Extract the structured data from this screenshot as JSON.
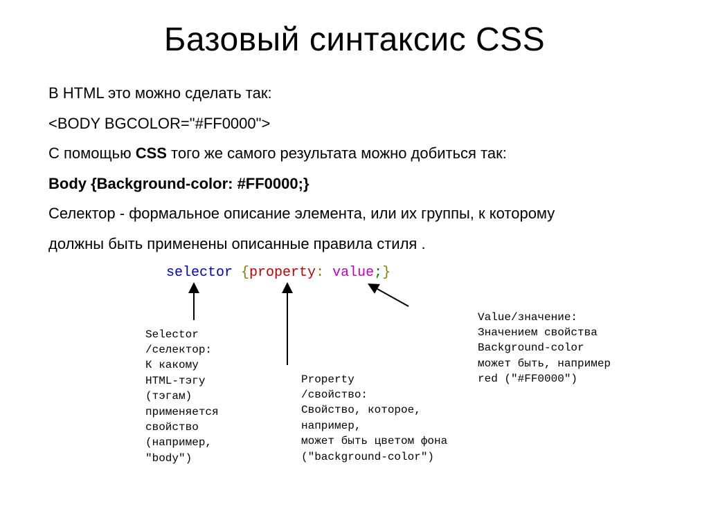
{
  "title": "Базовый синтаксис CSS",
  "intro": {
    "line1": "В HTML это можно сделать так:",
    "line2": "<BODY BGCOLOR=\"#FF0000\">",
    "line3_prefix": "С помощью ",
    "line3_bold": "CSS",
    "line3_suffix": " того же самого результата можно добиться так:",
    "line4": " Body {Background-color: #FF0000;}",
    "line5": "Селектор - формальное описание элемента, или их группы, к которому",
    "line6": "должны быть применены описанные правила стиля ."
  },
  "syntax": {
    "selector": "selector",
    "brace_open": "{",
    "property": "property",
    "colon": ":",
    "value": " value",
    "semicolon": ";",
    "brace_close": "}"
  },
  "desc": {
    "selector": "Selector\n/селектор:\nК какому\nHTML-тэгу\n(тэгам)\nприменяется\nсвойство\n(например,\n\"body\")",
    "property": "Property\n/свойство:\nСвойство, которое,\nнапример,\nможет быть цветом фона\n(\"background-color\")",
    "value": "Value/значение:\nЗначением свойства\nBackground-color\nможет быть, например\nred (\"#FF0000\")"
  }
}
